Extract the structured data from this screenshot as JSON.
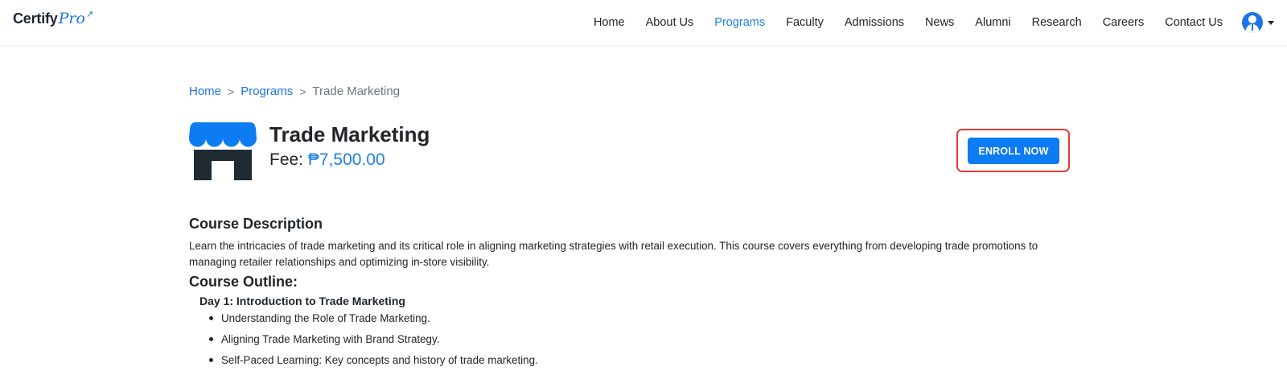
{
  "brand": {
    "name_part1": "Certify",
    "name_part2": "Pro"
  },
  "nav": {
    "items": [
      {
        "label": "Home",
        "active": false
      },
      {
        "label": "About Us",
        "active": false
      },
      {
        "label": "Programs",
        "active": true
      },
      {
        "label": "Faculty",
        "active": false
      },
      {
        "label": "Admissions",
        "active": false
      },
      {
        "label": "News",
        "active": false
      },
      {
        "label": "Alumni",
        "active": false
      },
      {
        "label": "Research",
        "active": false
      },
      {
        "label": "Careers",
        "active": false
      },
      {
        "label": "Contact Us",
        "active": false
      }
    ],
    "avatar_icon": "user-avatar-icon"
  },
  "breadcrumb": {
    "items": [
      "Home",
      "Programs"
    ],
    "current": "Trade Marketing",
    "separator": ">"
  },
  "course": {
    "icon": "store-icon",
    "title": "Trade Marketing",
    "fee_label": "Fee:",
    "fee_amount": "₱7,500.00",
    "enroll_label": "ENROLL NOW"
  },
  "description": {
    "heading": "Course Description",
    "text": "Learn the intricacies of trade marketing and its critical role in aligning marketing strategies with retail execution. This course covers everything from developing trade promotions to managing retailer relationships and optimizing in-store visibility."
  },
  "outline": {
    "heading": "Course Outline:",
    "days": [
      {
        "title": "Day 1: Introduction to Trade Marketing",
        "topics": [
          "Understanding the Role of Trade Marketing.",
          "Aligning Trade Marketing with Brand Strategy.",
          "Self-Paced Learning: Key concepts and history of trade marketing."
        ]
      }
    ]
  },
  "colors": {
    "accent": "#1e80e6",
    "button": "#0d7bf2",
    "highlight": "#e53935",
    "icon_dark": "#1f2a33"
  }
}
